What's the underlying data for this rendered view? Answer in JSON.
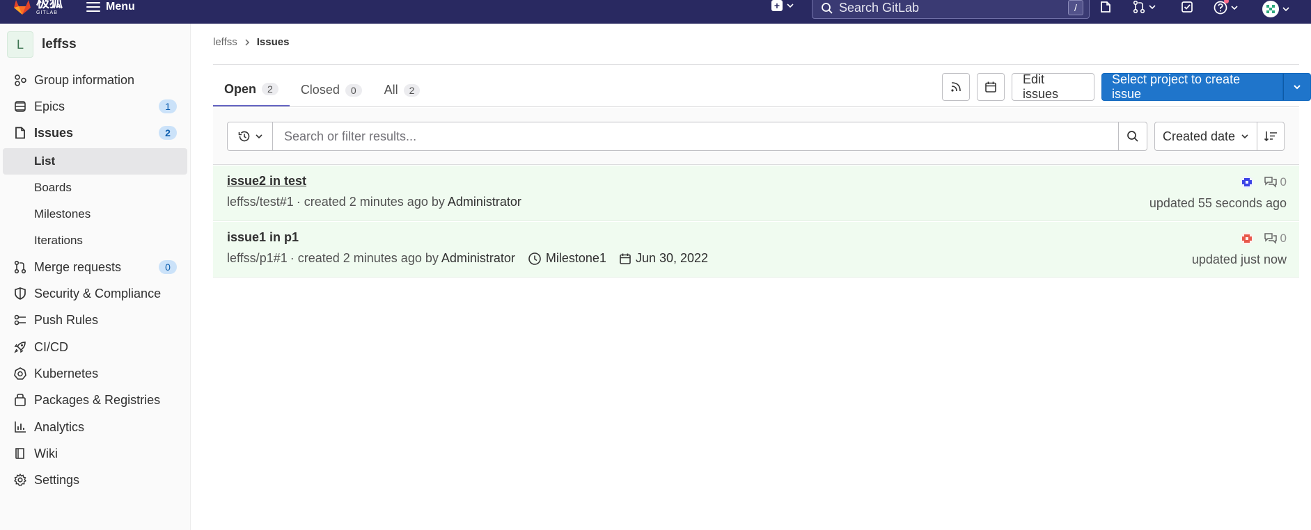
{
  "topbar": {
    "logo_cn": "极狐",
    "logo_en": "GITLAB",
    "menu_label": "Menu",
    "search_placeholder": "Search GitLab",
    "search_shortcut": "/"
  },
  "sidebar": {
    "group_initial": "L",
    "group_name": "leffss",
    "items": [
      {
        "label": "Group information",
        "icon": "group-icon"
      },
      {
        "label": "Epics",
        "icon": "epic-icon",
        "badge": "1"
      },
      {
        "label": "Issues",
        "icon": "issues-icon",
        "badge": "2"
      },
      {
        "label": "Merge requests",
        "icon": "merge-request-icon",
        "badge": "0"
      },
      {
        "label": "Security & Compliance",
        "icon": "shield-icon"
      },
      {
        "label": "Push Rules",
        "icon": "push-rules-icon"
      },
      {
        "label": "CI/CD",
        "icon": "rocket-icon"
      },
      {
        "label": "Kubernetes",
        "icon": "kubernetes-icon"
      },
      {
        "label": "Packages & Registries",
        "icon": "package-icon"
      },
      {
        "label": "Analytics",
        "icon": "chart-icon"
      },
      {
        "label": "Wiki",
        "icon": "book-icon"
      },
      {
        "label": "Settings",
        "icon": "gear-icon"
      }
    ],
    "issues_sub": [
      "List",
      "Boards",
      "Milestones",
      "Iterations"
    ]
  },
  "breadcrumb": {
    "parent": "leffss",
    "current": "Issues"
  },
  "tabs": [
    {
      "label": "Open",
      "count": "2"
    },
    {
      "label": "Closed",
      "count": "0"
    },
    {
      "label": "All",
      "count": "2"
    }
  ],
  "actions": {
    "edit_label": "Edit issues",
    "create_label": "Select project to create issue"
  },
  "filter": {
    "placeholder": "Search or filter results...",
    "sort_label": "Created date"
  },
  "issues": [
    {
      "title": "issue2 in test",
      "ref": "leffss/test#1",
      "created": "· created 2 minutes ago by",
      "author": "Administrator",
      "comments": "0",
      "updated": "updated 55 seconds ago",
      "avatar_color": "#3b43e6"
    },
    {
      "title": "issue1 in p1",
      "ref": "leffss/p1#1",
      "created": "· created 2 minutes ago by",
      "author": "Administrator",
      "milestone": "Milestone1",
      "due": "Jun 30, 2022",
      "comments": "0",
      "updated": "updated just now",
      "avatar_color": "#e8584b"
    }
  ]
}
